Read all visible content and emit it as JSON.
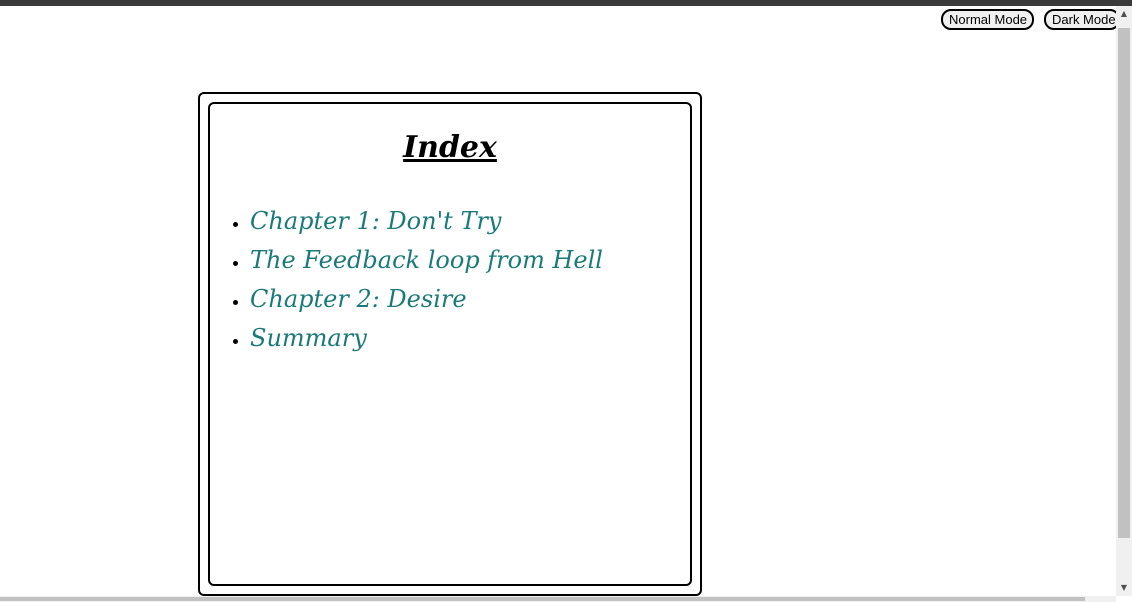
{
  "header": {
    "normal_mode_label": "Normal Mode",
    "dark_mode_label": "Dark Mode"
  },
  "index": {
    "title": "Index",
    "items": [
      {
        "label": "Chapter 1: Don't Try"
      },
      {
        "label": "The Feedback loop from Hell"
      },
      {
        "label": "Chapter 2: Desire"
      },
      {
        "label": "Summary"
      }
    ]
  },
  "colors": {
    "link": "#1a7a7a",
    "border": "#000000",
    "background": "#ffffff"
  }
}
